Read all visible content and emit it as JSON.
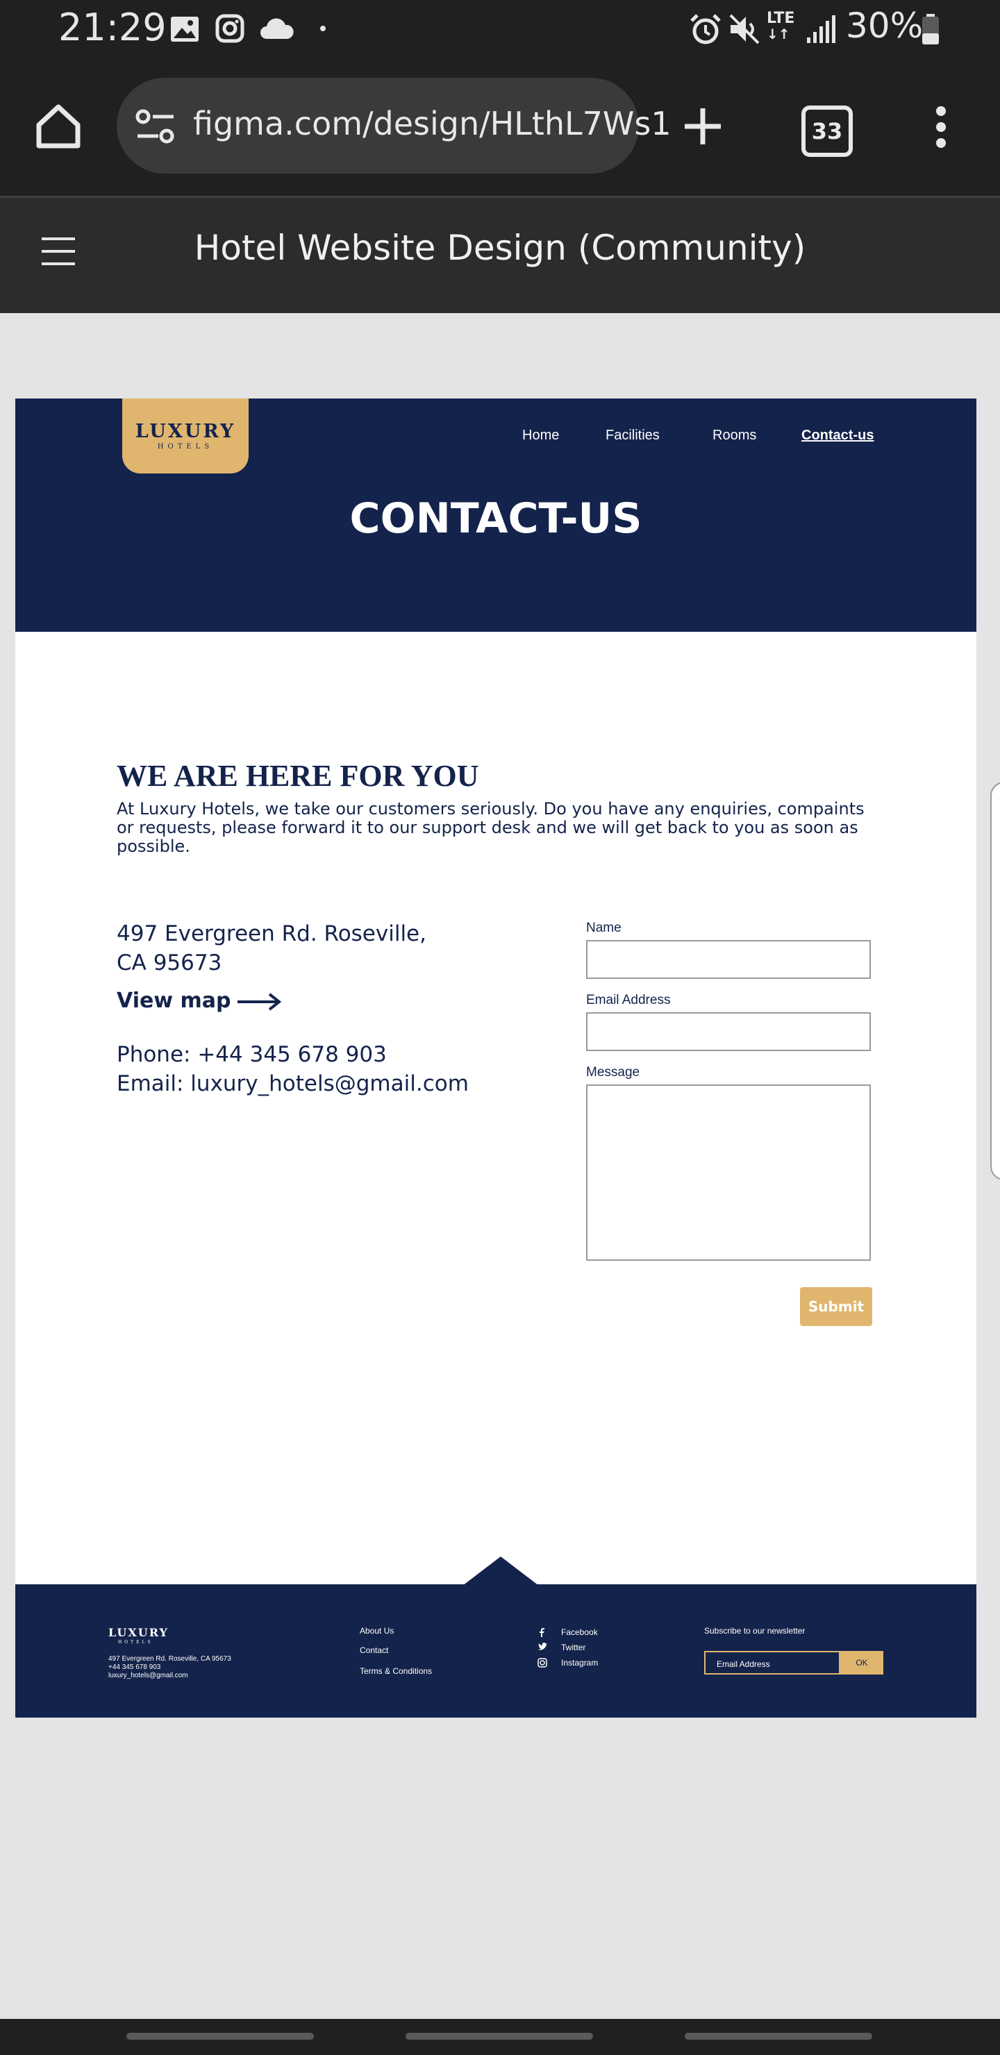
{
  "status_bar": {
    "time": "21:29",
    "battery": "30%",
    "network": "LTE",
    "icons": [
      "gallery-icon",
      "instagram-icon",
      "cloud-icon",
      "dot-icon",
      "alarm-icon",
      "mute-icon",
      "lte-icon",
      "signal-icon",
      "battery-icon"
    ]
  },
  "browser": {
    "url": "figma.com/design/HLthL7Ws1",
    "tab_count": "33",
    "icons": [
      "home-icon",
      "site-settings-icon",
      "plus-icon",
      "menu-dots-icon"
    ]
  },
  "figma": {
    "title": "Hotel Website Design (Community)"
  },
  "design": {
    "logo_main": "LUXURY",
    "logo_sub": "HOTELS",
    "nav": {
      "home": "Home",
      "facilities": "Facilities",
      "rooms": "Rooms",
      "contact": "Contact-us"
    },
    "page_title": "CONTACT-US",
    "heading": "WE ARE HERE FOR YOU",
    "intro": "At Luxury Hotels, we take our customers seriously. Do you have any enquiries, compaints or requests, please forward it to our support desk and we will get back to you as soon as possible.",
    "address_line1": "497 Evergreen Rd. Roseville,",
    "address_line2": "CA 95673",
    "view_map": "View map",
    "phone": "Phone: +44 345 678 903",
    "email": "Email: luxury_hotels@gmail.com",
    "form": {
      "name_label": "Name",
      "email_label": "Email Address",
      "message_label": "Message",
      "submit": "Submit"
    },
    "colors": {
      "navy": "#14234b",
      "gold": "#e0b66f"
    },
    "footer": {
      "logo_main": "LUXURY",
      "logo_sub": "HOTELS",
      "address": "497 Evergreen Rd. Roseville, CA 95673",
      "phone": "+44 345 678 903",
      "email": "luxury_hotels@gmail.com",
      "links": {
        "about": "About Us",
        "contact": "Contact",
        "terms": "Terms & Conditions"
      },
      "social": {
        "facebook": "Facebook",
        "twitter": "Twitter",
        "instagram": "Instagram"
      },
      "newsletter_title": "Subscribe to our newsletter",
      "newsletter_placeholder": "Email Address",
      "newsletter_button": "OK"
    }
  }
}
